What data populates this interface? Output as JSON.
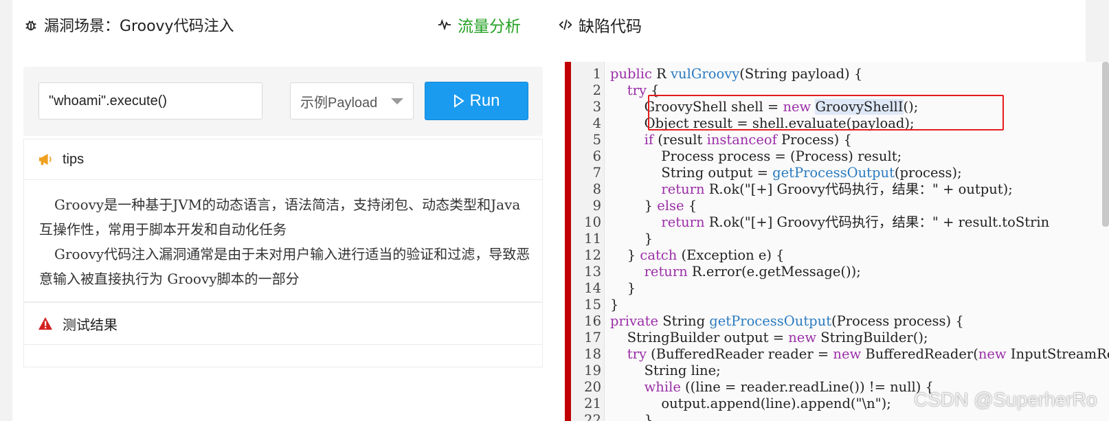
{
  "header": {
    "title_icon": "bug-icon",
    "title": "漏洞场景：Groovy代码注入",
    "tabs": [
      {
        "icon": "activity-pulse-icon",
        "label": "流量分析",
        "color": "#22a022"
      },
      {
        "icon": "code-icon",
        "label": "缺陷代码"
      }
    ]
  },
  "controls": {
    "payload_value": "\"whoami\".execute()",
    "select_label": "示例Payload",
    "run_label": "Run",
    "run_icon": "play-outline-icon",
    "run_color": "#1a9bf0"
  },
  "tips": {
    "icon": "megaphone-icon",
    "title": "tips",
    "paragraphs": [
      "Groovy是一种基于JVM的动态语言，语法简洁，支持闭包、动态类型和Java互操作性，常用于脚本开发和自动化任务",
      "Groovy代码注入漏洞通常是由于未对用户输入进行适当的验证和过滤，导致恶意输入被直接执行为 Groovy脚本的一部分"
    ]
  },
  "result": {
    "icon": "warning-icon",
    "title": "测试结果"
  },
  "code": {
    "highlight_color": "#e61b1b",
    "line_numbers": [
      "1",
      "2",
      "3",
      "4",
      "5",
      "6",
      "7",
      "8",
      "9",
      "10",
      "11",
      "12",
      "13",
      "14",
      "15",
      "16",
      "17",
      "18",
      "19",
      "20",
      "21",
      "22"
    ],
    "lines": [
      "public R vulGroovy(String payload) {",
      "    try {",
      "        GroovyShell shell = new GroovyShellI();",
      "        Object result = shell.evaluate(payload);",
      "        if (result instanceof Process) {",
      "            Process process = (Process) result;",
      "            String output = getProcessOutput(process);",
      "            return R.ok(\"[+] Groovy代码执行，结果：\" + output);",
      "        } else {",
      "            return R.ok(\"[+] Groovy代码执行，结果：\" + result.toStrin",
      "        }",
      "    } catch (Exception e) {",
      "        return R.error(e.getMessage());",
      "    }",
      "}",
      "private String getProcessOutput(Process process) {",
      "    StringBuilder output = new StringBuilder();",
      "    try (BufferedReader reader = new BufferedReader(new InputStreamRe",
      "        String line;",
      "        while ((line = reader.readLine()) != null) {",
      "            output.append(line).append(\"\\n\");",
      "        }"
    ]
  },
  "watermark": "CSDN @SuperherRo"
}
